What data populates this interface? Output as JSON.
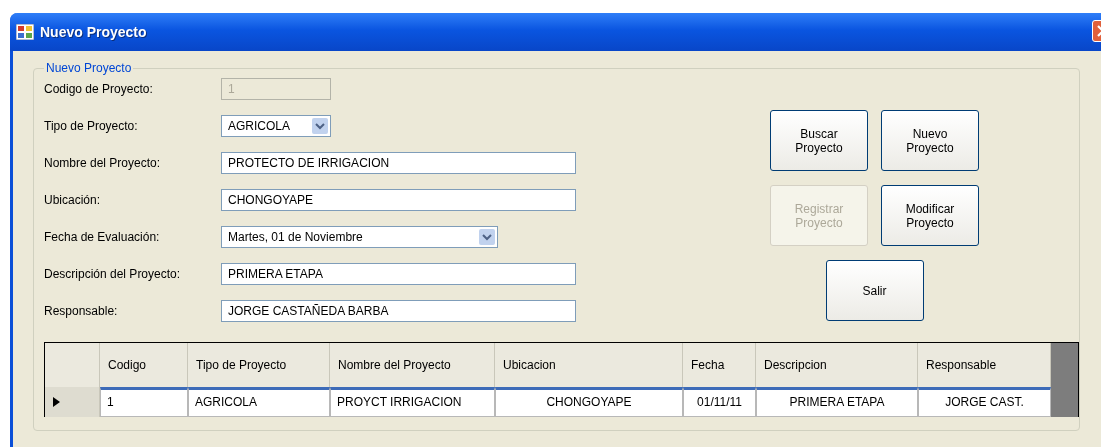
{
  "window": {
    "title": "Nuevo Proyecto"
  },
  "group": {
    "title": "Nuevo Proyecto"
  },
  "fields": [
    {
      "kind": "text",
      "label": "Codigo de Proyecto:",
      "value": "1",
      "disabled": true
    },
    {
      "kind": "combo",
      "label": "Tipo de Proyecto:",
      "value": "AGRICOLA",
      "disabled": false
    },
    {
      "kind": "text",
      "label": "Nombre del Proyecto:",
      "value": "PROTECTO DE IRRIGACION",
      "disabled": false
    },
    {
      "kind": "text",
      "label": "Ubicación:",
      "value": "CHONGOYAPE",
      "disabled": false
    },
    {
      "kind": "combo",
      "label": "Fecha de Evaluación:",
      "value": "Martes, 01 de Noviembre",
      "disabled": false
    },
    {
      "kind": "text",
      "label": "Descripción del Proyecto:",
      "value": "PRIMERA ETAPA",
      "disabled": false
    },
    {
      "kind": "text",
      "label": "Responsable:",
      "value": "JORGE CASTAÑEDA BARBA",
      "disabled": false
    }
  ],
  "buttons": [
    {
      "label": "Buscar Proyecto",
      "disabled": false
    },
    {
      "label": "Nuevo Proyecto",
      "disabled": false
    },
    {
      "label": "Registrar Proyecto",
      "disabled": true
    },
    {
      "label": "Modificar Proyecto",
      "disabled": false
    },
    {
      "label": "Salir",
      "disabled": false
    }
  ],
  "table": {
    "columns": [
      "Codigo",
      "Tipo de Proyecto",
      "Nombre del Proyecto",
      "Ubicacion",
      "Fecha",
      "Descripcion",
      "Responsable"
    ],
    "rows": [
      {
        "selected": true,
        "cells": [
          "1",
          "AGRICOLA",
          "PROYCT IRRIGACION",
          "CHONGOYAPE",
          "01/11/11",
          "PRIMERA ETAPA",
          "JORGE CAST."
        ]
      }
    ]
  }
}
